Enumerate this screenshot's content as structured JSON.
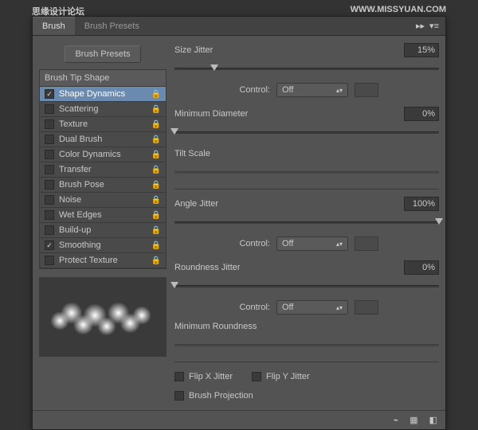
{
  "watermark": {
    "left": "思缘设计论坛",
    "right": "WWW.MISSYUAN.COM"
  },
  "tabs": {
    "brush": "Brush",
    "presets": "Brush Presets"
  },
  "preset_button": "Brush Presets",
  "options": {
    "tip_shape": "Brush Tip Shape",
    "shape_dynamics": "Shape Dynamics",
    "scattering": "Scattering",
    "texture": "Texture",
    "dual_brush": "Dual Brush",
    "color_dynamics": "Color Dynamics",
    "transfer": "Transfer",
    "brush_pose": "Brush Pose",
    "noise": "Noise",
    "wet_edges": "Wet Edges",
    "buildup": "Build-up",
    "smoothing": "Smoothing",
    "protect_texture": "Protect Texture"
  },
  "settings": {
    "size_jitter": {
      "label": "Size Jitter",
      "value": "15%"
    },
    "control1": {
      "label": "Control:",
      "value": "Off"
    },
    "min_diameter": {
      "label": "Minimum Diameter",
      "value": "0%"
    },
    "tilt_scale": {
      "label": "Tilt Scale"
    },
    "angle_jitter": {
      "label": "Angle Jitter",
      "value": "100%"
    },
    "control2": {
      "label": "Control:",
      "value": "Off"
    },
    "roundness_jitter": {
      "label": "Roundness Jitter",
      "value": "0%"
    },
    "control3": {
      "label": "Control:",
      "value": "Off"
    },
    "min_roundness": {
      "label": "Minimum Roundness"
    },
    "flip_x": "Flip X Jitter",
    "flip_y": "Flip Y Jitter",
    "brush_projection": "Brush Projection"
  }
}
